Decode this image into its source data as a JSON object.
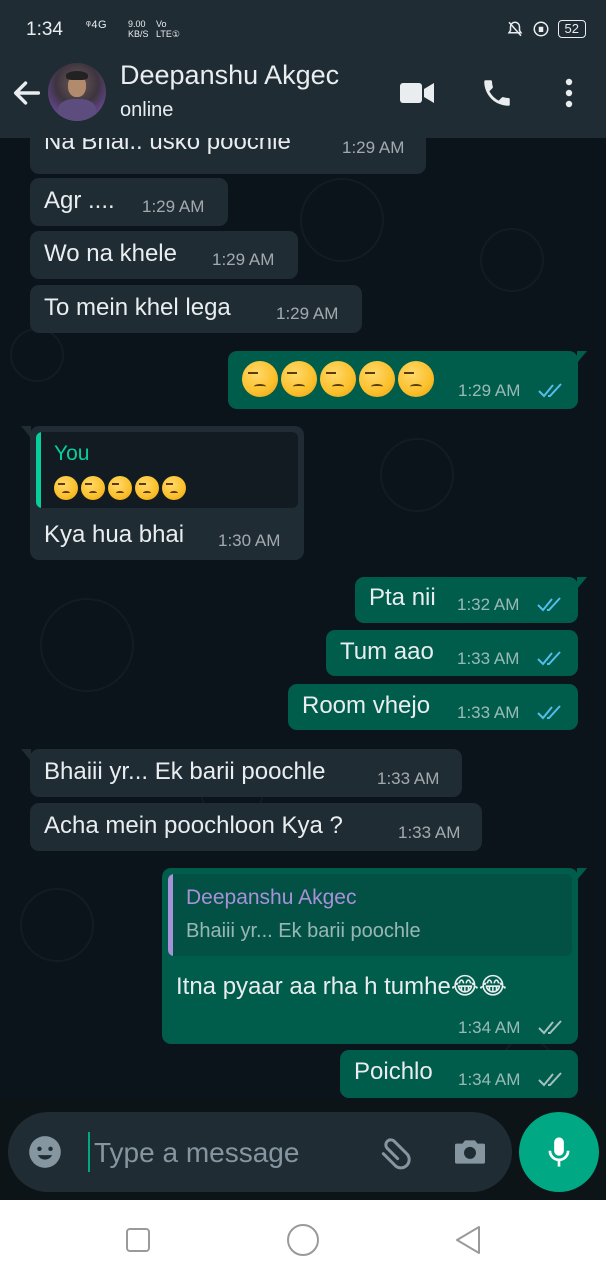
{
  "status_bar": {
    "time": "1:34",
    "network": "ᵠ4G",
    "speed_value": "9.00",
    "speed_unit": "KB/S",
    "lte_top": "Vo",
    "lte_bottom": "LTE①",
    "battery": "52"
  },
  "header": {
    "contact_name": "Deepanshu Akgec",
    "status": "online"
  },
  "messages": [
    {
      "dir": "in",
      "text": "Na Bhai.. usko poochle",
      "time": "1:29 AM"
    },
    {
      "dir": "in",
      "text": "Agr ....",
      "time": "1:29 AM"
    },
    {
      "dir": "in",
      "text": "Wo na khele",
      "time": "1:29 AM"
    },
    {
      "dir": "in",
      "text": "To mein khel lega",
      "time": "1:29 AM"
    },
    {
      "dir": "out",
      "text": "😒😒😒😒😒",
      "time": "1:29 AM",
      "ticks": "read"
    },
    {
      "dir": "in",
      "quote_author": "You",
      "quote_text": "😒😒😒😒😒",
      "text": "Kya hua bhai",
      "time": "1:30 AM"
    },
    {
      "dir": "out",
      "text": "Pta nii",
      "time": "1:32 AM",
      "ticks": "read"
    },
    {
      "dir": "out",
      "text": "Tum aao",
      "time": "1:33 AM",
      "ticks": "read"
    },
    {
      "dir": "out",
      "text": "Room vhejo",
      "time": "1:33 AM",
      "ticks": "read"
    },
    {
      "dir": "in",
      "text": "Bhaiii yr... Ek barii poochle",
      "time": "1:33 AM"
    },
    {
      "dir": "in",
      "text": "Acha mein poochloon Kya ?",
      "time": "1:33 AM"
    },
    {
      "dir": "out",
      "quote_author": "Deepanshu Akgec",
      "quote_text": "Bhaiii yr... Ek barii poochle",
      "text": "Itna pyaar aa rha h tumhe😂😂",
      "time": "1:34 AM",
      "ticks": "delivered"
    },
    {
      "dir": "out",
      "text": "Poichlo",
      "time": "1:34 AM",
      "ticks": "delivered"
    }
  ],
  "composer": {
    "placeholder": "Type a message"
  },
  "icons": {
    "back": "back-arrow-icon",
    "video": "video-call-icon",
    "phone": "voice-call-icon",
    "menu": "more-vert-icon",
    "emoji": "emoji-icon",
    "attach": "paperclip-icon",
    "camera": "camera-icon",
    "mic": "mic-icon"
  },
  "colors": {
    "background": "#0b141a",
    "bar": "#1f2c33",
    "incoming_bubble": "#1f2c33",
    "outgoing_bubble": "#005c4b",
    "accent": "#00a884",
    "read_ticks": "#53bdeb",
    "quote_you": "#06cf9c",
    "quote_contact": "#a791d9"
  }
}
